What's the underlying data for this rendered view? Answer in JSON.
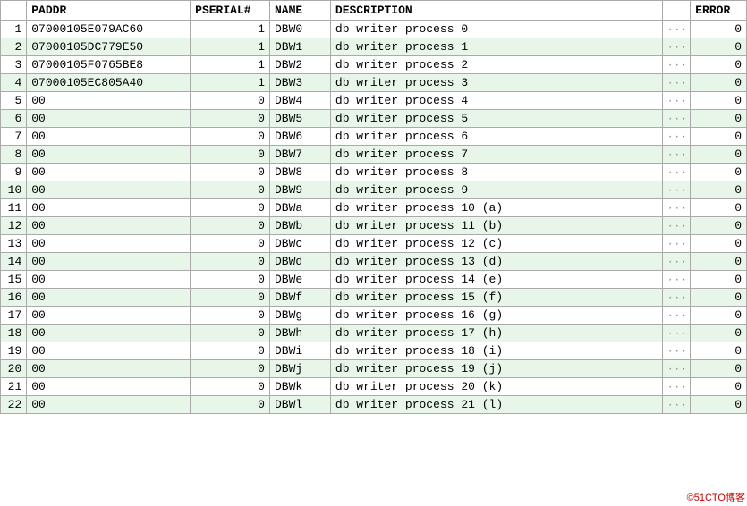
{
  "table": {
    "columns": [
      "",
      "PADDR",
      "PSERIAL#",
      "NAME",
      "DESCRIPTION",
      "",
      "ERROR"
    ],
    "rows": [
      {
        "rownum": 1,
        "paddr": "07000105E079AC60",
        "pserial": 1,
        "name": "DBW0",
        "description": "db writer process 0",
        "error": 0
      },
      {
        "rownum": 2,
        "paddr": "07000105DC779E50",
        "pserial": 1,
        "name": "DBW1",
        "description": "db writer process 1",
        "error": 0
      },
      {
        "rownum": 3,
        "paddr": "07000105F0765BE8",
        "pserial": 1,
        "name": "DBW2",
        "description": "db writer process 2",
        "error": 0
      },
      {
        "rownum": 4,
        "paddr": "07000105EC805A40",
        "pserial": 1,
        "name": "DBW3",
        "description": "db writer process 3",
        "error": 0
      },
      {
        "rownum": 5,
        "paddr": "00",
        "pserial": 0,
        "name": "DBW4",
        "description": "db writer process 4",
        "error": 0
      },
      {
        "rownum": 6,
        "paddr": "00",
        "pserial": 0,
        "name": "DBW5",
        "description": "db writer process 5",
        "error": 0
      },
      {
        "rownum": 7,
        "paddr": "00",
        "pserial": 0,
        "name": "DBW6",
        "description": "db writer process 6",
        "error": 0
      },
      {
        "rownum": 8,
        "paddr": "00",
        "pserial": 0,
        "name": "DBW7",
        "description": "db writer process 7",
        "error": 0
      },
      {
        "rownum": 9,
        "paddr": "00",
        "pserial": 0,
        "name": "DBW8",
        "description": "db writer process 8",
        "error": 0
      },
      {
        "rownum": 10,
        "paddr": "00",
        "pserial": 0,
        "name": "DBW9",
        "description": "db writer process 9",
        "error": 0
      },
      {
        "rownum": 11,
        "paddr": "00",
        "pserial": 0,
        "name": "DBWa",
        "description": "db writer process 10 (a)",
        "error": 0
      },
      {
        "rownum": 12,
        "paddr": "00",
        "pserial": 0,
        "name": "DBWb",
        "description": "db writer process 11 (b)",
        "error": 0
      },
      {
        "rownum": 13,
        "paddr": "00",
        "pserial": 0,
        "name": "DBWc",
        "description": "db writer process 12 (c)",
        "error": 0
      },
      {
        "rownum": 14,
        "paddr": "00",
        "pserial": 0,
        "name": "DBWd",
        "description": "db writer process 13 (d)",
        "error": 0
      },
      {
        "rownum": 15,
        "paddr": "00",
        "pserial": 0,
        "name": "DBWe",
        "description": "db writer process 14 (e)",
        "error": 0
      },
      {
        "rownum": 16,
        "paddr": "00",
        "pserial": 0,
        "name": "DBWf",
        "description": "db writer process 15 (f)",
        "error": 0
      },
      {
        "rownum": 17,
        "paddr": "00",
        "pserial": 0,
        "name": "DBWg",
        "description": "db writer process 16 (g)",
        "error": 0
      },
      {
        "rownum": 18,
        "paddr": "00",
        "pserial": 0,
        "name": "DBWh",
        "description": "db writer process 17 (h)",
        "error": 0
      },
      {
        "rownum": 19,
        "paddr": "00",
        "pserial": 0,
        "name": "DBWi",
        "description": "db writer process 18 (i)",
        "error": 0
      },
      {
        "rownum": 20,
        "paddr": "00",
        "pserial": 0,
        "name": "DBWj",
        "description": "db writer process 19 (j)",
        "error": 0
      },
      {
        "rownum": 21,
        "paddr": "00",
        "pserial": 0,
        "name": "DBWk",
        "description": "db writer process 20 (k)",
        "error": 0
      },
      {
        "rownum": 22,
        "paddr": "00",
        "pserial": 0,
        "name": "DBWl",
        "description": "db writer process 21 (l)",
        "error": 0
      }
    ]
  },
  "watermark": "©51CTO博客"
}
